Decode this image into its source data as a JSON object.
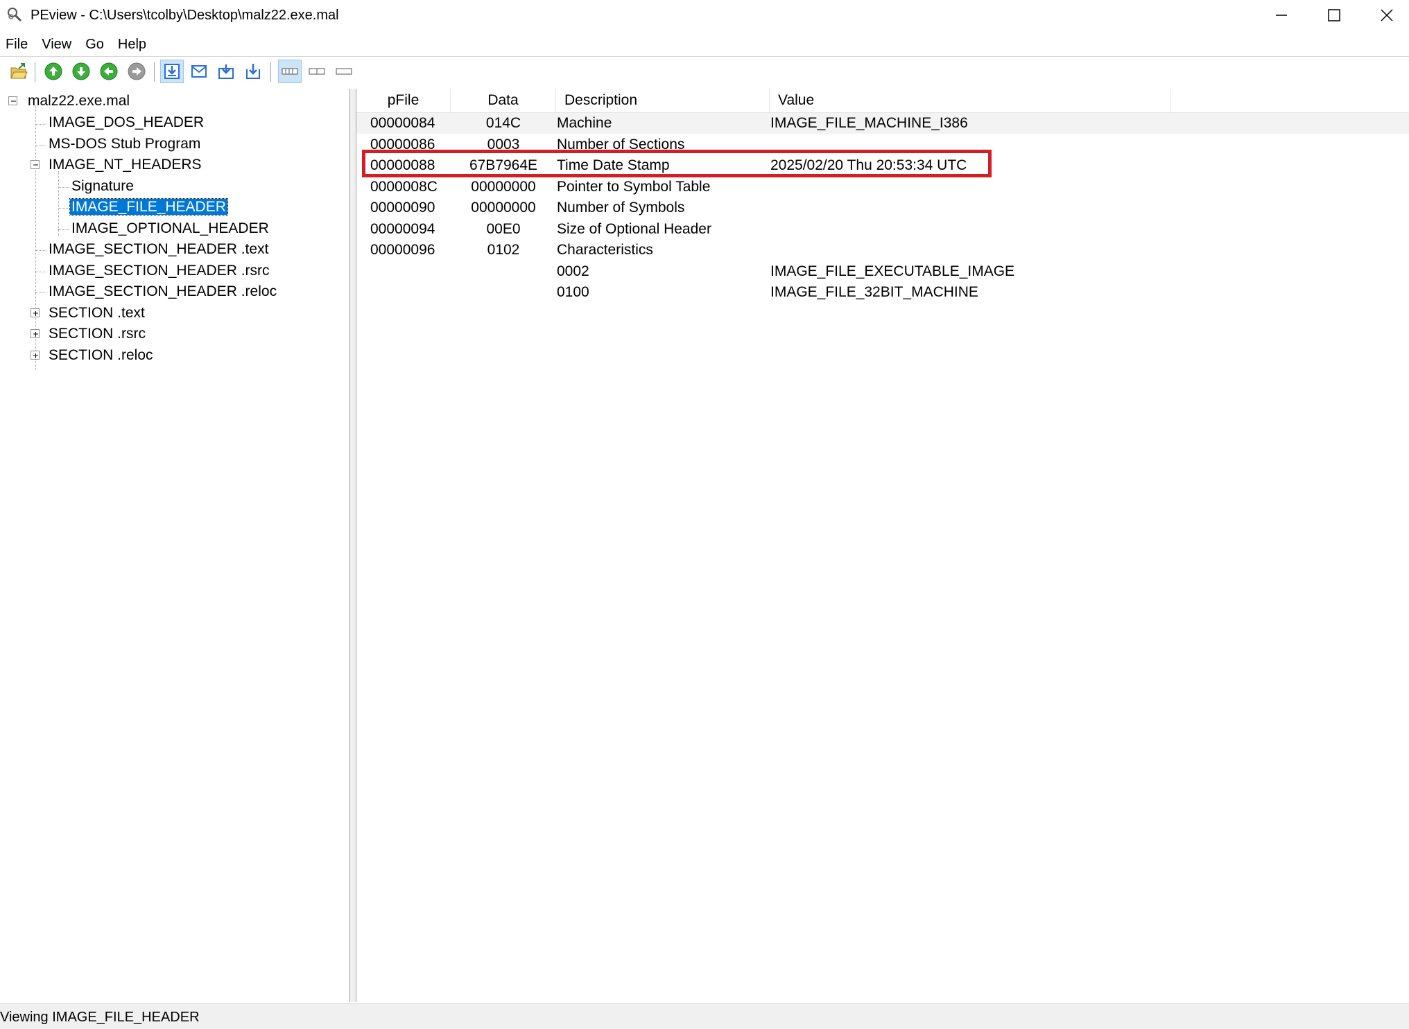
{
  "window": {
    "title": "PEview - C:\\Users\\tcolby\\Desktop\\malz22.exe.mal"
  },
  "menu": {
    "items": [
      "File",
      "View",
      "Go",
      "Help"
    ]
  },
  "toolbar": {
    "buttons": [
      "open-file-icon",
      "up-arrow-icon",
      "down-arrow-icon",
      "back-arrow-icon",
      "forward-arrow-icon",
      "view-hex-icon",
      "view-mail-icon",
      "view-import-icon",
      "view-export-icon",
      "layout-wide-icon",
      "layout-split-icon",
      "layout-narrow-icon"
    ]
  },
  "tree": {
    "items": [
      {
        "label": "malz22.exe.mal",
        "expander": "minus"
      },
      {
        "label": "IMAGE_DOS_HEADER"
      },
      {
        "label": "MS-DOS Stub Program"
      },
      {
        "label": "IMAGE_NT_HEADERS",
        "expander": "minus"
      },
      {
        "label": "Signature"
      },
      {
        "label": "IMAGE_FILE_HEADER",
        "selected": true
      },
      {
        "label": "IMAGE_OPTIONAL_HEADER"
      },
      {
        "label": "IMAGE_SECTION_HEADER .text"
      },
      {
        "label": "IMAGE_SECTION_HEADER .rsrc"
      },
      {
        "label": "IMAGE_SECTION_HEADER .reloc"
      },
      {
        "label": "SECTION .text",
        "expander": "plus"
      },
      {
        "label": "SECTION .rsrc",
        "expander": "plus"
      },
      {
        "label": "SECTION .reloc",
        "expander": "plus"
      }
    ]
  },
  "table": {
    "columns": [
      "pFile",
      "Data",
      "Description",
      "Value"
    ],
    "rows": [
      [
        "00000084",
        "014C",
        "Machine",
        "IMAGE_FILE_MACHINE_I386"
      ],
      [
        "00000086",
        "0003",
        "Number of Sections",
        ""
      ],
      [
        "00000088",
        "67B7964E",
        "Time Date Stamp",
        "2025/02/20 Thu 20:53:34 UTC"
      ],
      [
        "0000008C",
        "00000000",
        "Pointer to Symbol Table",
        ""
      ],
      [
        "00000090",
        "00000000",
        "Number of Symbols",
        ""
      ],
      [
        "00000094",
        "00E0",
        "Size of Optional Header",
        ""
      ],
      [
        "00000096",
        "0102",
        "Characteristics",
        ""
      ],
      [
        "",
        "",
        "0002",
        "IMAGE_FILE_EXECUTABLE_IMAGE"
      ],
      [
        "",
        "",
        "0100",
        "IMAGE_FILE_32BIT_MACHINE"
      ]
    ],
    "highlighted_row": 2,
    "hover_row": 0,
    "highlight_color": "#d21f26"
  },
  "status": {
    "text": "Viewing IMAGE_FILE_HEADER"
  },
  "colors": {
    "selection": "#0078d7",
    "toolbar_green": "#3cae3c",
    "toolbar_blue": "#2a6fd6"
  }
}
